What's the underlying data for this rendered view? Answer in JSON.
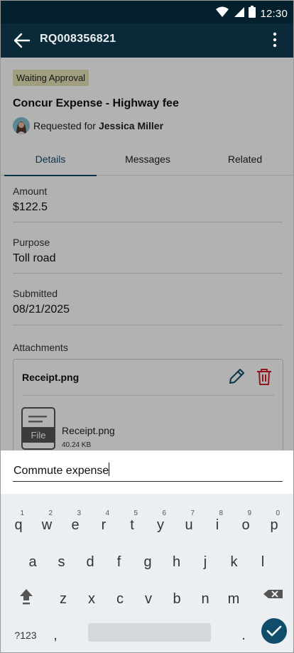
{
  "status_bar": {
    "time": "12:30",
    "icons": [
      "wifi-icon",
      "signal-icon",
      "battery-icon"
    ]
  },
  "app_bar": {
    "title": "RQ008356821",
    "back_icon": "arrow-left-icon",
    "menu_icon": "more-vertical-icon"
  },
  "request": {
    "status_badge": "Waiting Approval",
    "title": "Concur Expense - Highway fee",
    "requested_for_label": "Requested for",
    "requester_name": "Jessica Miller"
  },
  "tabs": [
    {
      "label": "Details",
      "active": true
    },
    {
      "label": "Messages",
      "active": false
    },
    {
      "label": "Related",
      "active": false
    }
  ],
  "details": {
    "amount_label": "Amount",
    "amount_value": "$122.5",
    "purpose_label": "Purpose",
    "purpose_value": "Toll road",
    "submitted_label": "Submitted",
    "submitted_value": "08/21/2025",
    "attachments_label": "Attachments"
  },
  "attachment": {
    "name": "Receipt.png",
    "file_icon_label": "File",
    "file_name": "Receipt.png",
    "file_size": "40.24 KB"
  },
  "input": {
    "value": "Commute expense"
  },
  "keyboard": {
    "row1": [
      {
        "ch": "q",
        "hint": "1"
      },
      {
        "ch": "w",
        "hint": "2"
      },
      {
        "ch": "e",
        "hint": "3"
      },
      {
        "ch": "r",
        "hint": "4"
      },
      {
        "ch": "t",
        "hint": "5"
      },
      {
        "ch": "y",
        "hint": "6"
      },
      {
        "ch": "u",
        "hint": "7"
      },
      {
        "ch": "i",
        "hint": "8"
      },
      {
        "ch": "o",
        "hint": "9"
      },
      {
        "ch": "p",
        "hint": "0"
      }
    ],
    "row2": [
      "a",
      "s",
      "d",
      "f",
      "g",
      "h",
      "j",
      "k",
      "l"
    ],
    "row3": [
      "z",
      "x",
      "c",
      "v",
      "b",
      "n",
      "m"
    ],
    "symbols_label": "?123",
    "comma": ",",
    "period": "."
  },
  "colors": {
    "status_bar": "#05202d",
    "app_bar": "#0a2a39",
    "accent": "#0f4d6a",
    "badge": "#e7e2b6",
    "delete": "#d0202e"
  }
}
